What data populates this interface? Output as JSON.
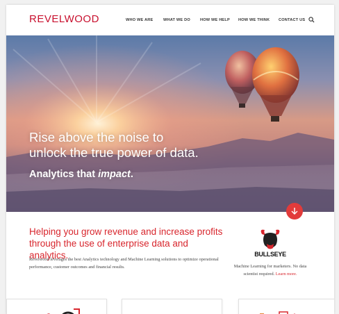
{
  "header": {
    "logo_text": "REVELWOOD",
    "nav": [
      {
        "label": "WHO WE ARE"
      },
      {
        "label": "WHAT WE DO"
      },
      {
        "label": "HOW WE HELP"
      },
      {
        "label": "HOW WE THINK"
      },
      {
        "label": "CONTACT US"
      }
    ],
    "search_icon": "search-icon"
  },
  "hero": {
    "headline_line1": "Rise above the noise to",
    "headline_line2": "unlock the true power of data.",
    "subheadline_prefix": "Analytics that ",
    "subheadline_emphasis": "impact",
    "subheadline_suffix": ".",
    "scroll_icon": "arrow-down-icon"
  },
  "intro": {
    "heading": "Helping you grow revenue and increase profits through the use of enterprise data and analytics.",
    "body": "Revelwood leverages the best Analytics technology and Machine Learning solutions to optimize operational performance, customer outcomes and financial results."
  },
  "bullseye": {
    "logo_text": "BULLSEYE",
    "description": "Machine Learning for marketers. No data scientist required.",
    "link_text": "Learn more."
  },
  "colors": {
    "brand_red": "#d8262d",
    "nav_text": "#333333"
  }
}
